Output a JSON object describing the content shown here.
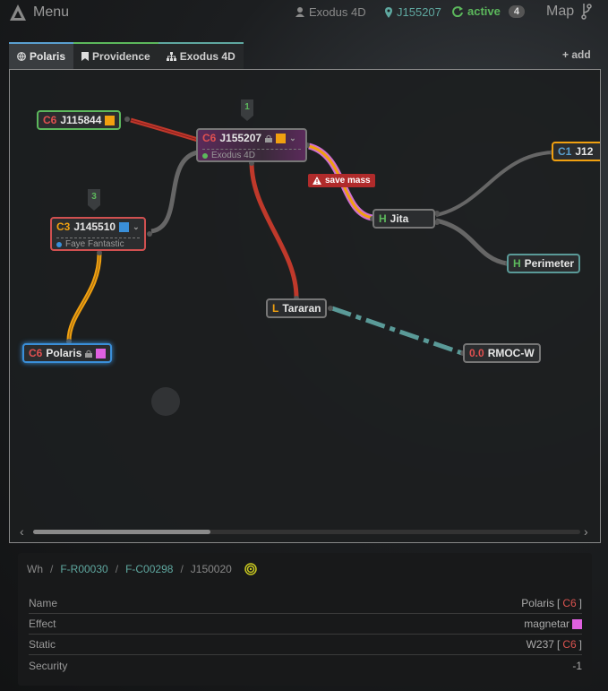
{
  "header": {
    "menu_label": "Menu",
    "character": "Exodus 4D",
    "system": "J155207",
    "status": "active",
    "status_count": "4",
    "map_label": "Map"
  },
  "tabs": [
    {
      "label": "Polaris",
      "icon": "globe-icon",
      "color": "#5aa0d0",
      "active": true
    },
    {
      "label": "Providence",
      "icon": "bookmark-icon",
      "color": "#5cb85c",
      "active": false
    },
    {
      "label": "Exodus 4D",
      "icon": "sitemap-icon",
      "color": "#5fa8a0",
      "active": false
    }
  ],
  "add_tab_label": "add",
  "systems": [
    {
      "id": "j115844",
      "class": "C6",
      "name": "J115844",
      "effect_color": "#f0a010"
    },
    {
      "id": "j155207",
      "class": "C6",
      "name": "J155207",
      "alias": "Exodus 4D",
      "effect_color": "#f0a010",
      "marker": "1"
    },
    {
      "id": "j145510",
      "class": "C3",
      "name": "J145510",
      "alias": "Faye Fantastic",
      "effect_color": "#3a8fd9",
      "marker": "3"
    },
    {
      "id": "polaris",
      "class": "C6",
      "name": "Polaris",
      "effect_color": "#e060e0"
    },
    {
      "id": "jita",
      "class": "H",
      "name": "Jita"
    },
    {
      "id": "perimeter",
      "class": "H",
      "name": "Perimeter"
    },
    {
      "id": "tararan",
      "class": "L",
      "name": "Tararan"
    },
    {
      "id": "rmoc",
      "class": "0.0",
      "name": "RMOC-W"
    },
    {
      "id": "j12",
      "class": "C1",
      "name": "J12"
    }
  ],
  "connection_label": "save mass",
  "breadcrumb": {
    "root": "Wh",
    "region": "F-R00030",
    "constellation": "F-C00298",
    "system": "J150020"
  },
  "info": {
    "rows": [
      {
        "label": "Name",
        "value": "Polaris",
        "class": "C6"
      },
      {
        "label": "Effect",
        "value": "magnetar",
        "color": "#e060e0"
      },
      {
        "label": "Static",
        "value": "W237",
        "class": "C6"
      },
      {
        "label": "Security",
        "value": "-1"
      }
    ]
  },
  "colors": {
    "C6": "#e05050",
    "C3": "#f0a010",
    "C1": "#5aa0d0",
    "H": "#5cb85c",
    "L": "#f0a010",
    "null": "#e05050"
  }
}
